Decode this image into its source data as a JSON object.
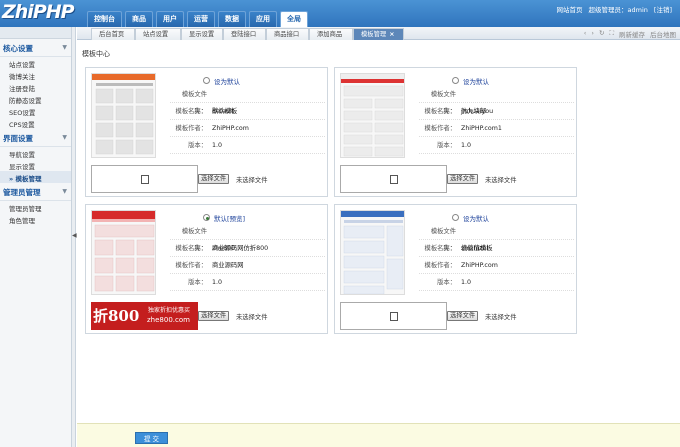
{
  "app": {
    "logo": "ZhiPHP"
  },
  "nav": [
    {
      "label": "控制台"
    },
    {
      "label": "商品"
    },
    {
      "label": "用户"
    },
    {
      "label": "运营"
    },
    {
      "label": "数据"
    },
    {
      "label": "应用"
    },
    {
      "label": "全局"
    }
  ],
  "user": {
    "home": "网站首页",
    "admin": "超级管理员：admin",
    "logout": "[注销]"
  },
  "sidebar": {
    "groups": [
      {
        "title": "核心设置",
        "items": [
          "站点设置",
          "微博关注",
          "注册登陆",
          "防静态设置",
          "SEO设置",
          "CPS设置"
        ]
      },
      {
        "title": "界面设置",
        "items": [
          "导航设置",
          "显示设置",
          "模板管理"
        ]
      },
      {
        "title": "管理员管理",
        "items": [
          "管理员管理",
          "角色管理"
        ]
      }
    ],
    "active": "模板管理"
  },
  "tabs": [
    "后台首页",
    "站点设置",
    "显示设置",
    "登陆接口",
    "商品接口",
    "添加商品",
    "模板管理"
  ],
  "tab_close": "×",
  "tabtools": {
    "refresh": "刷新缓存",
    "map": "后台地图"
  },
  "breadcrumb": "模板中心",
  "field_labels": {
    "folder": "模板文件夹：",
    "name": "模板名称：",
    "author": "模板作者：",
    "version": "版本："
  },
  "file": {
    "button": "选择文件",
    "none": "未选择文件"
  },
  "templates": [
    {
      "radio": "设为默认",
      "folder": "default",
      "name": "默认模板",
      "author": "ZhiPHP.com",
      "version": "1.0",
      "checked": false
    },
    {
      "radio": "设为默认",
      "folder": "jiukuaiyou",
      "name": "仿九块邮",
      "author": "ZhiPHP.com1",
      "version": "1.0",
      "checked": false
    },
    {
      "radio": "默认[预览]",
      "folder": "zhe800",
      "name": "商业源码网仿折800",
      "author": "商业源码网",
      "version": "1.0",
      "checked": true,
      "banner": {
        "big": "折800",
        "s1": "独家折扣优惠买",
        "s2": "zhe800.com"
      }
    },
    {
      "radio": "设为默认",
      "folder": "zhizhizhi",
      "name": "值值值模板",
      "author": "ZhiPHP.com",
      "version": "1.0",
      "checked": false
    }
  ],
  "submit": "提 交"
}
